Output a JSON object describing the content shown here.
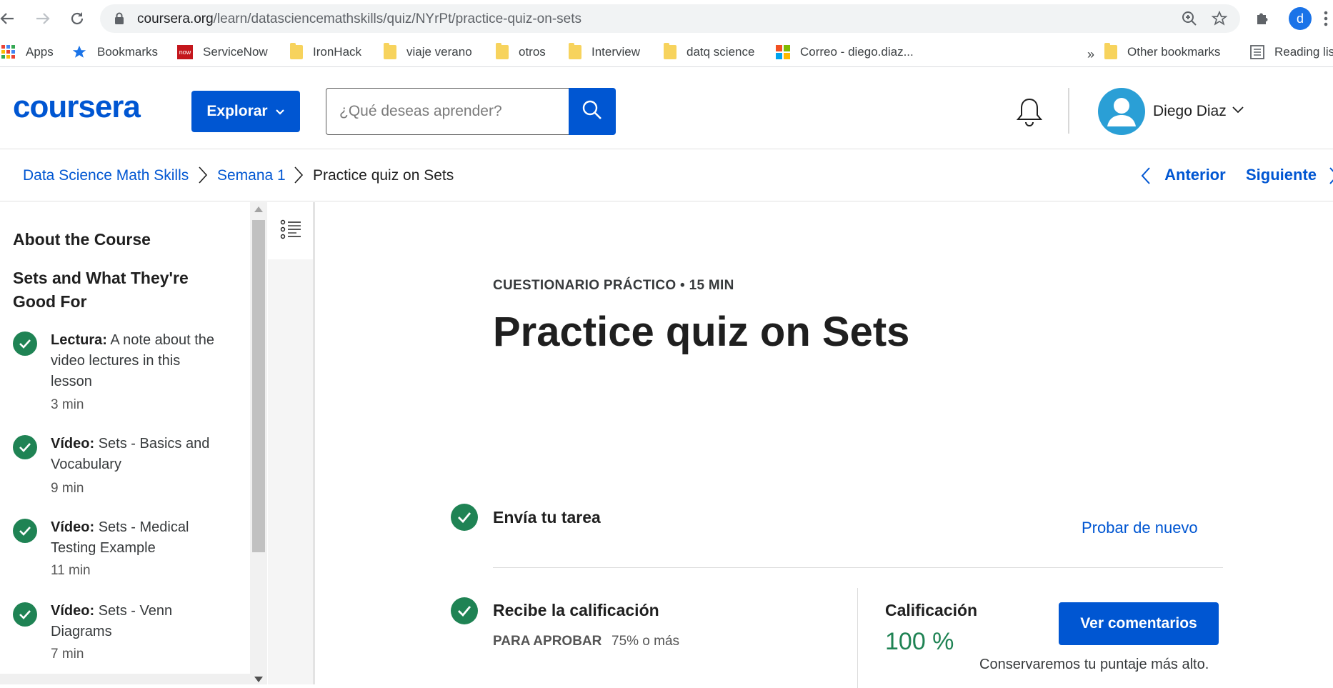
{
  "browser": {
    "url_host": "coursera.org",
    "url_path": "/learn/datasciencemathskills/quiz/NYrPt/practice-quiz-on-sets",
    "profile_initial": "d"
  },
  "bookmarks": {
    "apps": "Apps",
    "bookmarks": "Bookmarks",
    "servicenow": "ServiceNow",
    "ironhack": "IronHack",
    "viaje": "viaje verano",
    "otros": "otros",
    "interview": "Interview",
    "datq": "datq science",
    "correo": "Correo - diego.diaz...",
    "overflow": "»",
    "other": "Other bookmarks",
    "reading": "Reading list",
    "servicenow_badge": "now"
  },
  "header": {
    "logo": "coursera",
    "explore_label": "Explorar",
    "search_placeholder": "¿Qué deseas aprender?",
    "user_name": "Diego Diaz"
  },
  "breadcrumb": {
    "course": "Data Science Math Skills",
    "week": "Semana 1",
    "current": "Practice quiz on Sets",
    "prev": "Anterior",
    "next": "Siguiente"
  },
  "sidebar": {
    "about": "About the Course",
    "section": "Sets and What They're Good For",
    "items": [
      {
        "type": "Lectura:",
        "title": "A note about the video lectures in this lesson",
        "duration": "3 min"
      },
      {
        "type": "Vídeo:",
        "title": "Sets - Basics and Vocabulary",
        "duration": "9 min"
      },
      {
        "type": "Vídeo:",
        "title": "Sets - Medical Testing Example",
        "duration": "11 min"
      },
      {
        "type": "Vídeo:",
        "title": "Sets - Venn Diagrams",
        "duration": "7 min"
      }
    ]
  },
  "main": {
    "kicker": "CUESTIONARIO PRÁCTICO • 15 MIN",
    "title": "Practice quiz on Sets",
    "step1_title": "Envía tu tarea",
    "retry": "Probar de nuevo",
    "step2_title": "Recibe la calificación",
    "pass_label": "PARA APROBAR",
    "pass_value": "75% o más",
    "grade_label": "Calificación",
    "grade_value": "100 %",
    "feedback_button": "Ver comentarios",
    "keep_note": "Conservaremos tu puntaje más alto."
  },
  "colors": {
    "brand": "#0056d2",
    "success": "#1f8354"
  }
}
